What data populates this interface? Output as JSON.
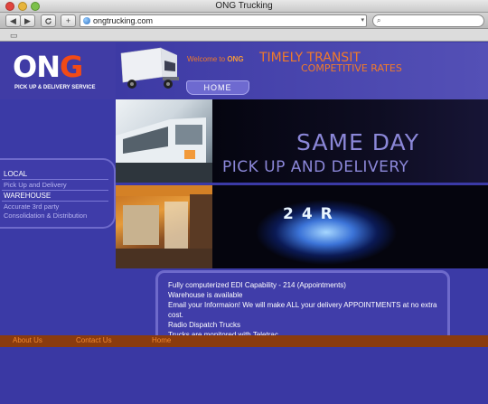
{
  "window": {
    "title": "ONG Trucking"
  },
  "toolbar": {
    "back_icon": "◀",
    "forward_icon": "▶",
    "reload_icon": "reload-icon",
    "add_icon": "+",
    "url": "ongtrucking.com",
    "search_placeholder": "Q▾"
  },
  "header": {
    "logo_main": "ONG",
    "logo_sub": "PICK UP & DELIVERY SERVICE",
    "welcome_prefix": "Welcome to",
    "welcome_brand": "ONG",
    "tagline": "TIMELY TRANSIT",
    "tagline2": "COMPETITIVE RATES",
    "home_tab": "HOME"
  },
  "menu": {
    "local": "LOCAL",
    "pickup": "Pick Up and Delivery",
    "warehouse": "WAREHOUSE",
    "third_party": "Accurate 3rd party",
    "consolidation": "Consolidation & Distribution"
  },
  "banner": {
    "line1": "SAME DAY",
    "line2": "PICK UP AND DELIVERY",
    "clock": "24R"
  },
  "info": {
    "line1": "Fully computerized EDI Capability - 214 (Appointments)",
    "line2": " Warehouse is available",
    "line3": "Email your Informaion! We will make ALL your delivery APPOINTMENTS at no extra",
    "line4": "cost.",
    "line5": "Radio Dispatch Trucks",
    "line6": "Trucks are monitored with Teletrac"
  },
  "footer": {
    "about": "About Us",
    "contact": "Contact Us",
    "home": "Home"
  },
  "colors": {
    "page_bg": "#3b3aa6",
    "accent_orange": "#f07a2a",
    "footer_bar": "#8a3b0e",
    "banner_text": "#8b87d8"
  }
}
